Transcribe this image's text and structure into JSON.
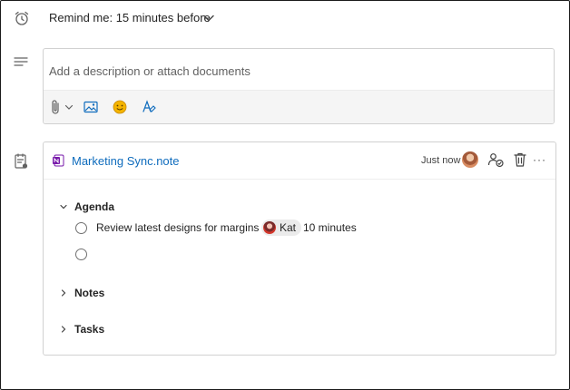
{
  "reminder": {
    "label": "Remind me: 15 minutes before",
    "icon": "alarm-clock-icon"
  },
  "description": {
    "placeholder": "Add a description or attach documents",
    "toolbar": [
      "paperclip-icon",
      "chevron-down-icon",
      "image-icon",
      "emoji-icon",
      "text-format-icon"
    ]
  },
  "loop_component": {
    "title": "Marketing Sync.note",
    "timestamp": "Just now",
    "sections": [
      {
        "label": "Agenda",
        "expanded": true,
        "tasks": [
          {
            "text": "Review latest designs for margins",
            "assignee": "Kat",
            "duration": "10 minutes",
            "completed": false
          },
          {
            "text": "",
            "completed": false
          }
        ]
      },
      {
        "label": "Notes",
        "expanded": false
      },
      {
        "label": "Tasks",
        "expanded": false
      }
    ]
  },
  "colors": {
    "link": "#0f6cbd",
    "border": "#d1d1d1",
    "toolbar_bg": "#f5f5f5",
    "emoji": "#f4b400"
  }
}
